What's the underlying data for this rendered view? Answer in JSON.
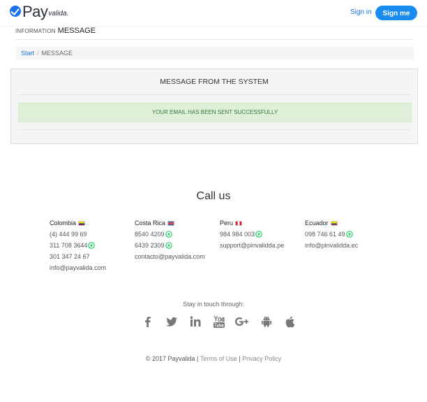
{
  "header": {
    "logo_pay": "Pay",
    "logo_valida": "valida.",
    "signin": "Sign in",
    "signup": "Sign me up"
  },
  "page": {
    "title_small": "INFORMATION",
    "title_main": "MESSAGE"
  },
  "breadcrumb": {
    "start": "Start",
    "separator": "/",
    "current": "MESSAGE"
  },
  "panel": {
    "title": "MESSAGE FROM THE SYSTEM",
    "alert": "YOUR EMAIL HAS BEEN SENT SUCCESSFULLY"
  },
  "contact": {
    "heading": "Call us",
    "countries": [
      {
        "name": "Colombia",
        "flag": "colombia-flag",
        "lines": [
          "(4) 444 99 69",
          "311 708 3644",
          "301 347 24 67",
          "info@payvalida.com"
        ],
        "whatsapp": [
          false,
          true,
          false,
          false
        ]
      },
      {
        "name": "Costa Rica",
        "flag": "costa-rica-flag",
        "lines": [
          "8540 4209",
          "6439 2309",
          "contacto@payvalida.com"
        ],
        "whatsapp": [
          true,
          true,
          false
        ]
      },
      {
        "name": "Peru",
        "flag": "peru-flag",
        "lines": [
          "984 984 003",
          "support@pinvalidda.pe"
        ],
        "whatsapp": [
          true,
          false
        ]
      },
      {
        "name": "Ecuador",
        "flag": "ecuador-flag",
        "lines": [
          "098 746 61 49",
          "info@pinvalidda.ec"
        ],
        "whatsapp": [
          true,
          false
        ]
      }
    ]
  },
  "social": {
    "label": "Stay in touch through:",
    "icons": [
      "facebook-icon",
      "twitter-icon",
      "linkedin-icon",
      "youtube-icon",
      "google-plus-icon",
      "android-icon",
      "apple-icon"
    ]
  },
  "footer": {
    "copyright": "© 2017 Payvalida",
    "divider": "|",
    "terms": "Terms of Use",
    "privacy": "Privacy Policy"
  },
  "colors": {
    "accent": "#1a8cf0",
    "alert_bg": "#dff0d8",
    "alert_text": "#3c763d",
    "whatsapp": "#25d366"
  }
}
